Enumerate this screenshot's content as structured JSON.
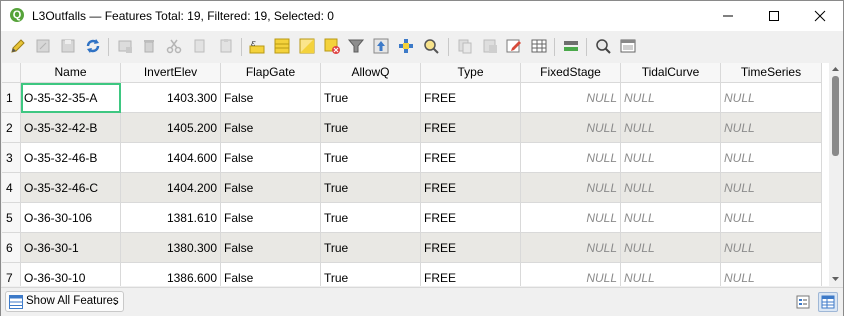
{
  "window": {
    "title": "L3Outfalls — Features Total: 19, Filtered: 19, Selected: 0",
    "logo_letter": "Q"
  },
  "table": {
    "columns": [
      "Name",
      "InvertElev",
      "FlapGate",
      "AllowQ",
      "Type",
      "FixedStage",
      "TidalCurve",
      "TimeSeries"
    ],
    "rows": [
      {
        "num": "1",
        "Name": "O-35-32-35-A",
        "InvertElev": "1403.300",
        "FlapGate": "False",
        "AllowQ": "True",
        "Type": "FREE",
        "FixedStage": "NULL",
        "TidalCurve": "NULL",
        "TimeSeries": "NULL"
      },
      {
        "num": "2",
        "Name": "O-35-32-42-B",
        "InvertElev": "1405.200",
        "FlapGate": "False",
        "AllowQ": "True",
        "Type": "FREE",
        "FixedStage": "NULL",
        "TidalCurve": "NULL",
        "TimeSeries": "NULL"
      },
      {
        "num": "3",
        "Name": "O-35-32-46-B",
        "InvertElev": "1404.600",
        "FlapGate": "False",
        "AllowQ": "True",
        "Type": "FREE",
        "FixedStage": "NULL",
        "TidalCurve": "NULL",
        "TimeSeries": "NULL"
      },
      {
        "num": "4",
        "Name": "O-35-32-46-C",
        "InvertElev": "1404.200",
        "FlapGate": "False",
        "AllowQ": "True",
        "Type": "FREE",
        "FixedStage": "NULL",
        "TidalCurve": "NULL",
        "TimeSeries": "NULL"
      },
      {
        "num": "5",
        "Name": "O-36-30-106",
        "InvertElev": "1381.610",
        "FlapGate": "False",
        "AllowQ": "True",
        "Type": "FREE",
        "FixedStage": "NULL",
        "TidalCurve": "NULL",
        "TimeSeries": "NULL"
      },
      {
        "num": "6",
        "Name": "O-36-30-1",
        "InvertElev": "1380.300",
        "FlapGate": "False",
        "AllowQ": "True",
        "Type": "FREE",
        "FixedStage": "NULL",
        "TidalCurve": "NULL",
        "TimeSeries": "NULL"
      },
      {
        "num": "7",
        "Name": "O-36-30-10",
        "InvertElev": "1386.600",
        "FlapGate": "False",
        "AllowQ": "True",
        "Type": "FREE",
        "FixedStage": "NULL",
        "TidalCurve": "NULL",
        "TimeSeries": "NULL"
      }
    ]
  },
  "bottom": {
    "filter_button_label": "Show All Features"
  },
  "colors": {
    "selection_outline": "#3ec781",
    "alt_row": "#e9e8e4",
    "null_text": "#8c8c8c"
  },
  "toolbar_icons": [
    "toggle-editing-icon",
    "save-edits-icon",
    "reload-icon",
    "refresh-icon",
    "add-feature-icon",
    "delete-feature-icon",
    "cut-icon",
    "copy-icon",
    "paste-icon",
    "select-expression-icon",
    "select-all-icon",
    "invert-selection-icon",
    "deselect-all-icon",
    "filter-select-icon",
    "move-selection-top-icon",
    "pan-to-selection-icon",
    "zoom-to-selection-icon",
    "copy-selected-rows-icon",
    "paste-features-icon",
    "new-field-icon",
    "delete-field-icon",
    "field-calculator-icon",
    "conditional-formatting-icon",
    "actions-icon",
    "dock-icon"
  ]
}
